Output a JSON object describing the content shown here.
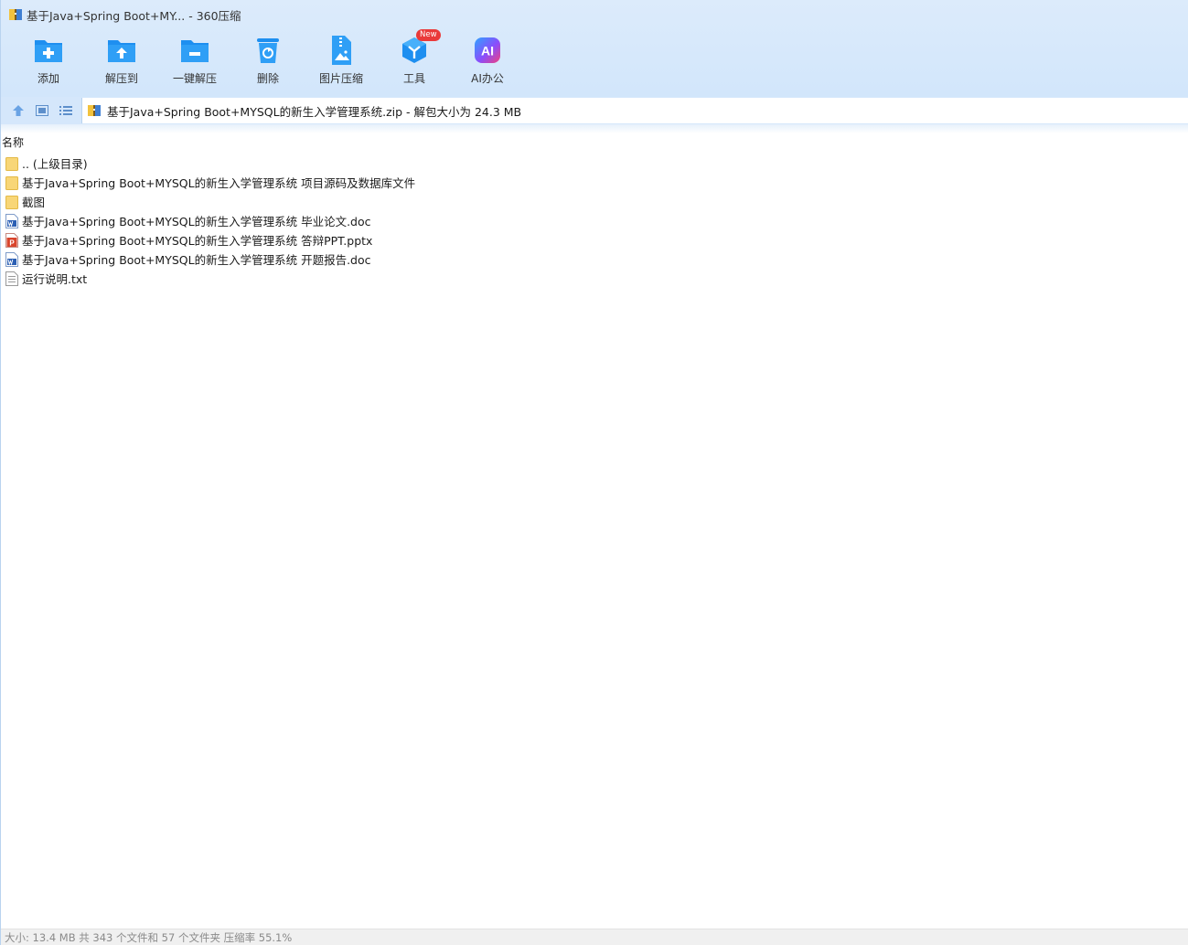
{
  "window": {
    "title": "基于Java+Spring Boot+MY... - 360压缩"
  },
  "toolbar": {
    "items": [
      {
        "label": "添加",
        "icon": "add-folder-icon"
      },
      {
        "label": "解压到",
        "icon": "extract-to-icon"
      },
      {
        "label": "一键解压",
        "icon": "one-click-extract-icon"
      },
      {
        "label": "删除",
        "icon": "delete-bin-icon"
      },
      {
        "label": "图片压缩",
        "icon": "image-compress-icon"
      },
      {
        "label": "工具",
        "icon": "tools-cube-icon",
        "badge": "New"
      },
      {
        "label": "AI办公",
        "icon": "ai-office-icon"
      }
    ]
  },
  "address": {
    "path": "基于Java+Spring Boot+MYSQL的新生入学管理系统.zip - 解包大小为 24.3 MB"
  },
  "list": {
    "column_header": "名称",
    "items": [
      {
        "name": ".. (上级目录)",
        "type": "folder"
      },
      {
        "name": "基于Java+Spring Boot+MYSQL的新生入学管理系统 项目源码及数据库文件",
        "type": "folder"
      },
      {
        "name": "截图",
        "type": "folder"
      },
      {
        "name": "基于Java+Spring Boot+MYSQL的新生入学管理系统 毕业论文.doc",
        "type": "word"
      },
      {
        "name": "基于Java+Spring Boot+MYSQL的新生入学管理系统 答辩PPT.pptx",
        "type": "ppt"
      },
      {
        "name": "基于Java+Spring Boot+MYSQL的新生入学管理系统 开题报告.doc",
        "type": "word"
      },
      {
        "name": "运行说明.txt",
        "type": "txt"
      }
    ]
  },
  "status": {
    "text": "大小: 13.4 MB 共 343 个文件和 57 个文件夹 压缩率 55.1%"
  },
  "colors": {
    "accent": "#1e90ef",
    "header_bg": "#d5e7fb",
    "folder": "#f8d677",
    "ppt": "#d9442b",
    "word": "#2b5fb4"
  }
}
